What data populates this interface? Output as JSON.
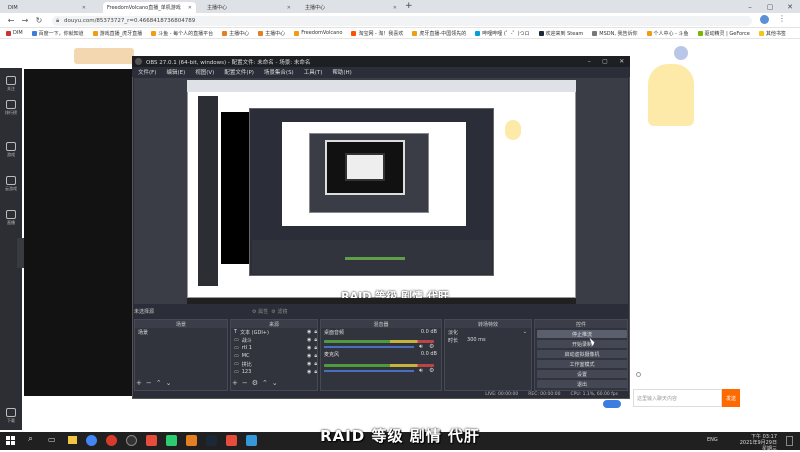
{
  "browser": {
    "tabs": [
      {
        "label": "DIM"
      },
      {
        "label": "FreedomVolcano直播_单机游戏"
      },
      {
        "label": "主播中心"
      },
      {
        "label": "主播中心"
      }
    ],
    "url": "douyu.com/85373727_r=0.4668418736804789",
    "bookmarks": [
      "DIM",
      "百度一下，你就知道",
      "游戏直播_虎牙直播",
      "斗鱼 - 每个人的直播平台",
      "主播中心",
      "主播中心",
      "FreedomVolcano",
      "淘宝网 - 淘！我喜欢",
      "虎牙直播-中国领先的",
      "哔哩哔哩 (゜-゜)つロ",
      "欢迎来到 Steam",
      "MSDN, 我告诉你",
      "个人中心 - 斗鱼",
      "驱动精灵 | GeForce",
      "其他书签"
    ]
  },
  "leftnav": {
    "items": [
      {
        "label": "关注"
      },
      {
        "label": "排行榜"
      },
      {
        "label": "游戏"
      },
      {
        "label": "云游戏"
      },
      {
        "label": "直播"
      },
      {
        "label": "下载"
      }
    ]
  },
  "obs": {
    "title": "OBS 27.0.1 (64-bit, windows) - 配置文件: 未命名 - 场景: 未命名",
    "menu": [
      "文件(F)",
      "编辑(E)",
      "视图(V)",
      "配置文件(P)",
      "场景集合(S)",
      "工具(T)",
      "帮助(H)"
    ],
    "preview_caption": "RAID 等级 剧情 代肝",
    "scene_label": "未选择源",
    "docks": {
      "scenes": {
        "header": "场景",
        "items": [
          "场景"
        ]
      },
      "sources": {
        "header": "来源",
        "items": [
          "文本 (GDI+)",
          "战斗",
          "rtl 1",
          "MC",
          "拼比",
          "123"
        ]
      },
      "mixer": {
        "header": "混音器",
        "channels": [
          {
            "name": "桌面音频",
            "db": "0.0 dB"
          },
          {
            "name": "麦克风",
            "db": "0.0 dB"
          }
        ]
      },
      "transitions": {
        "header": "转场特效",
        "type": "淡化",
        "duration_label": "时长",
        "duration": "300 ms"
      },
      "controls": {
        "header": "控件",
        "buttons": [
          "停止推流",
          "开始录制",
          "启动虚拟摄像机",
          "工作室模式",
          "设置",
          "退出"
        ]
      }
    },
    "status": [
      "LIVE: 00:00:00",
      "REC: 00:00:00",
      "CPU: 1.1%, 60.00 fps"
    ]
  },
  "chat": {
    "placeholder": "这里输入聊天内容",
    "send_label": "发送"
  },
  "taskbar": {
    "clock_time": "下午 03:17",
    "clock_date": "2021年9月29日 星期三",
    "lang": "ENG"
  },
  "subtitle": "RAID 等级 剧情 代肝",
  "colors": {
    "obs_bg": "#2b2e38",
    "accent": "#ff6a00",
    "browser_tab_bg": "#dee1e6"
  }
}
